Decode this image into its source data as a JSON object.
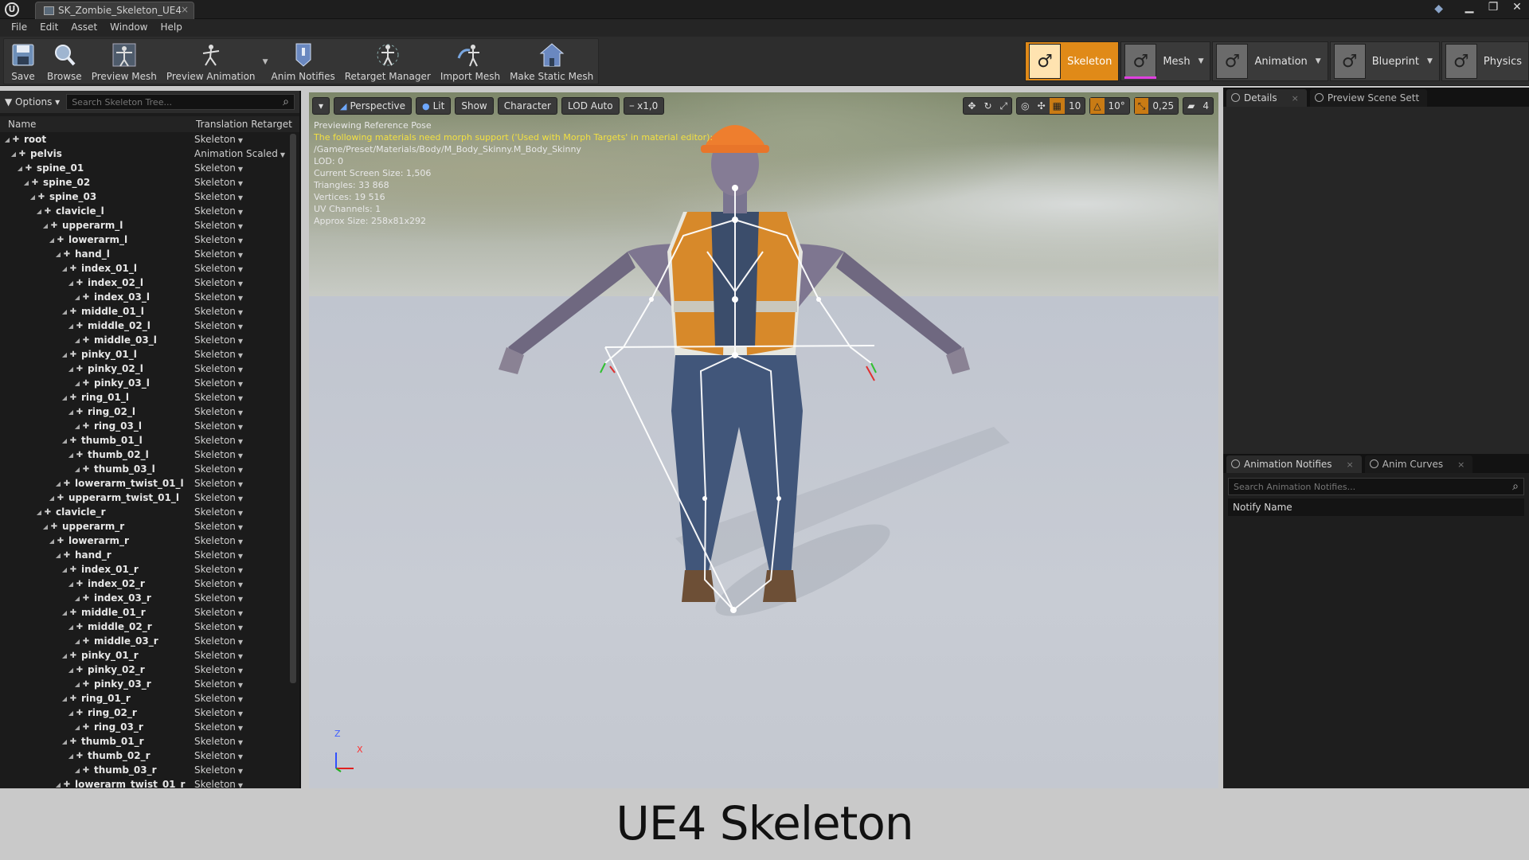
{
  "window": {
    "document_tab": "SK_Zombie_Skeleton_UE4",
    "controls": [
      "▁",
      "❐",
      "✕"
    ]
  },
  "menu": [
    "File",
    "Edit",
    "Asset",
    "Window",
    "Help"
  ],
  "toolbar": {
    "buttons": [
      {
        "label": "Save",
        "icon": "save-icon"
      },
      {
        "label": "Browse",
        "icon": "browse-icon"
      },
      {
        "label": "Preview Mesh",
        "icon": "preview-mesh-icon"
      },
      {
        "label": "Preview Animation",
        "icon": "preview-animation-icon"
      },
      {
        "label": "Anim Notifies",
        "icon": "anim-notifies-icon"
      },
      {
        "label": "Retarget Manager",
        "icon": "retarget-manager-icon"
      },
      {
        "label": "Import Mesh",
        "icon": "import-mesh-icon"
      },
      {
        "label": "Make Static Mesh",
        "icon": "make-static-mesh-icon"
      }
    ],
    "modes": [
      {
        "label": "Skeleton",
        "active": true,
        "bar_color": "#ffffff"
      },
      {
        "label": "Mesh",
        "active": false,
        "bar_color": "#e040e0"
      },
      {
        "label": "Animation",
        "active": false,
        "bar_color": ""
      },
      {
        "label": "Blueprint",
        "active": false,
        "bar_color": ""
      },
      {
        "label": "Physics",
        "active": false,
        "bar_color": ""
      }
    ]
  },
  "skeleton_tree": {
    "options_label": "Options",
    "search_placeholder": "Search Skeleton Tree...",
    "col_name": "Name",
    "col_retarget": "Translation Retarget",
    "rows": [
      {
        "name": "root",
        "depth": 0,
        "retarget": "Skeleton"
      },
      {
        "name": "pelvis",
        "depth": 1,
        "retarget": "Animation Scaled"
      },
      {
        "name": "spine_01",
        "depth": 2,
        "retarget": "Skeleton"
      },
      {
        "name": "spine_02",
        "depth": 3,
        "retarget": "Skeleton"
      },
      {
        "name": "spine_03",
        "depth": 4,
        "retarget": "Skeleton"
      },
      {
        "name": "clavicle_l",
        "depth": 5,
        "retarget": "Skeleton"
      },
      {
        "name": "upperarm_l",
        "depth": 6,
        "retarget": "Skeleton"
      },
      {
        "name": "lowerarm_l",
        "depth": 7,
        "retarget": "Skeleton"
      },
      {
        "name": "hand_l",
        "depth": 8,
        "retarget": "Skeleton"
      },
      {
        "name": "index_01_l",
        "depth": 9,
        "retarget": "Skeleton"
      },
      {
        "name": "index_02_l",
        "depth": 10,
        "retarget": "Skeleton"
      },
      {
        "name": "index_03_l",
        "depth": 11,
        "retarget": "Skeleton"
      },
      {
        "name": "middle_01_l",
        "depth": 9,
        "retarget": "Skeleton"
      },
      {
        "name": "middle_02_l",
        "depth": 10,
        "retarget": "Skeleton"
      },
      {
        "name": "middle_03_l",
        "depth": 11,
        "retarget": "Skeleton"
      },
      {
        "name": "pinky_01_l",
        "depth": 9,
        "retarget": "Skeleton"
      },
      {
        "name": "pinky_02_l",
        "depth": 10,
        "retarget": "Skeleton"
      },
      {
        "name": "pinky_03_l",
        "depth": 11,
        "retarget": "Skeleton"
      },
      {
        "name": "ring_01_l",
        "depth": 9,
        "retarget": "Skeleton"
      },
      {
        "name": "ring_02_l",
        "depth": 10,
        "retarget": "Skeleton"
      },
      {
        "name": "ring_03_l",
        "depth": 11,
        "retarget": "Skeleton"
      },
      {
        "name": "thumb_01_l",
        "depth": 9,
        "retarget": "Skeleton"
      },
      {
        "name": "thumb_02_l",
        "depth": 10,
        "retarget": "Skeleton"
      },
      {
        "name": "thumb_03_l",
        "depth": 11,
        "retarget": "Skeleton"
      },
      {
        "name": "lowerarm_twist_01_l",
        "depth": 8,
        "retarget": "Skeleton"
      },
      {
        "name": "upperarm_twist_01_l",
        "depth": 7,
        "retarget": "Skeleton"
      },
      {
        "name": "clavicle_r",
        "depth": 5,
        "retarget": "Skeleton"
      },
      {
        "name": "upperarm_r",
        "depth": 6,
        "retarget": "Skeleton"
      },
      {
        "name": "lowerarm_r",
        "depth": 7,
        "retarget": "Skeleton"
      },
      {
        "name": "hand_r",
        "depth": 8,
        "retarget": "Skeleton"
      },
      {
        "name": "index_01_r",
        "depth": 9,
        "retarget": "Skeleton"
      },
      {
        "name": "index_02_r",
        "depth": 10,
        "retarget": "Skeleton"
      },
      {
        "name": "index_03_r",
        "depth": 11,
        "retarget": "Skeleton"
      },
      {
        "name": "middle_01_r",
        "depth": 9,
        "retarget": "Skeleton"
      },
      {
        "name": "middle_02_r",
        "depth": 10,
        "retarget": "Skeleton"
      },
      {
        "name": "middle_03_r",
        "depth": 11,
        "retarget": "Skeleton"
      },
      {
        "name": "pinky_01_r",
        "depth": 9,
        "retarget": "Skeleton"
      },
      {
        "name": "pinky_02_r",
        "depth": 10,
        "retarget": "Skeleton"
      },
      {
        "name": "pinky_03_r",
        "depth": 11,
        "retarget": "Skeleton"
      },
      {
        "name": "ring_01_r",
        "depth": 9,
        "retarget": "Skeleton"
      },
      {
        "name": "ring_02_r",
        "depth": 10,
        "retarget": "Skeleton"
      },
      {
        "name": "ring_03_r",
        "depth": 11,
        "retarget": "Skeleton"
      },
      {
        "name": "thumb_01_r",
        "depth": 9,
        "retarget": "Skeleton"
      },
      {
        "name": "thumb_02_r",
        "depth": 10,
        "retarget": "Skeleton"
      },
      {
        "name": "thumb_03_r",
        "depth": 11,
        "retarget": "Skeleton"
      },
      {
        "name": "lowerarm_twist_01_r",
        "depth": 8,
        "retarget": "Skeleton"
      }
    ]
  },
  "viewport": {
    "toolbar": {
      "menu": "▾",
      "perspective": "Perspective",
      "lit": "Lit",
      "show": "Show",
      "character": "Character",
      "lod": "LOD Auto",
      "speed": "x1,0"
    },
    "snap": {
      "grid": "10",
      "rotation": "10°",
      "scale": "0,25",
      "camera_speed": "4"
    },
    "info": {
      "line1": "Previewing Reference Pose",
      "warning": "The following materials need morph support ('Used with Morph Targets' in material editor):",
      "material": "/Game/Preset/Materials/Body/M_Body_Skinny.M_Body_Skinny",
      "lod": "LOD: 0",
      "screen_size": "Current Screen Size: 1,506",
      "triangles": "Triangles: 33 868",
      "vertices": "Vertices: 19 516",
      "uv": "UV Channels: 1",
      "approx": "Approx Size: 258x81x292"
    },
    "axis": {
      "z": "Z",
      "x": "X"
    }
  },
  "right_panel": {
    "tabs_top": [
      "Details",
      "Preview Scene Sett"
    ],
    "tabs_bottom": [
      "Animation Notifies",
      "Anim Curves"
    ],
    "notify_search_placeholder": "Search Animation Notifies...",
    "notify_header": "Notify Name"
  },
  "caption": "UE4 Skeleton"
}
